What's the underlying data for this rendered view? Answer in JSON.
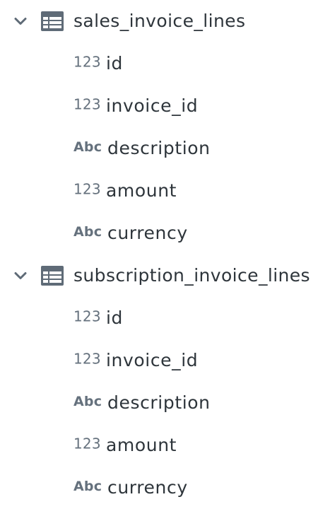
{
  "tables": [
    {
      "name": "sales_invoice_lines",
      "expanded": true,
      "fields": [
        {
          "type": "123",
          "kind": "number",
          "name": "id"
        },
        {
          "type": "123",
          "kind": "number",
          "name": "invoice_id"
        },
        {
          "type": "Abc",
          "kind": "text",
          "name": "description"
        },
        {
          "type": "123",
          "kind": "number",
          "name": "amount"
        },
        {
          "type": "Abc",
          "kind": "text",
          "name": "currency"
        }
      ]
    },
    {
      "name": "subscription_invoice_lines",
      "expanded": true,
      "fields": [
        {
          "type": "123",
          "kind": "number",
          "name": "id"
        },
        {
          "type": "123",
          "kind": "number",
          "name": "invoice_id"
        },
        {
          "type": "Abc",
          "kind": "text",
          "name": "description"
        },
        {
          "type": "123",
          "kind": "number",
          "name": "amount"
        },
        {
          "type": "Abc",
          "kind": "text",
          "name": "currency"
        }
      ]
    }
  ],
  "icons": {
    "expand": "chevron-down-icon",
    "table": "table-icon"
  },
  "colors": {
    "icon": "#5f6b77",
    "text": "#2e353b",
    "type_badge": "#65717d"
  }
}
